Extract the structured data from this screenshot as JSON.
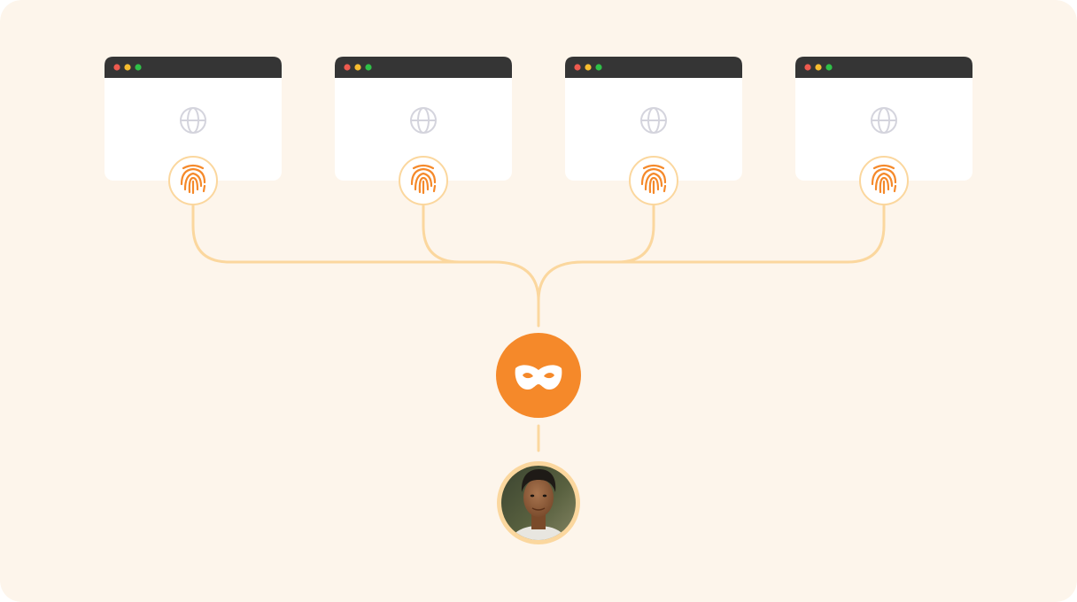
{
  "colors": {
    "background": "#fdf5eb",
    "window_titlebar": "#353535",
    "window_body": "#ffffff",
    "traffic_red": "#ee5a4f",
    "traffic_yellow": "#f5bc2f",
    "traffic_green": "#2fc048",
    "globe": "#d4d4dd",
    "accent_orange": "#f5892a",
    "connector": "#fbd79e",
    "badge_ring": "#fbd79e"
  },
  "browser_windows": [
    {
      "id": "window-1",
      "content_icon": "globe-icon",
      "badge_icon": "fingerprint-icon"
    },
    {
      "id": "window-2",
      "content_icon": "globe-icon",
      "badge_icon": "fingerprint-icon"
    },
    {
      "id": "window-3",
      "content_icon": "globe-icon",
      "badge_icon": "fingerprint-icon"
    },
    {
      "id": "window-4",
      "content_icon": "globe-icon",
      "badge_icon": "fingerprint-icon"
    }
  ],
  "hub": {
    "icon": "mask-icon"
  },
  "user": {
    "icon": "user-avatar-photo"
  }
}
